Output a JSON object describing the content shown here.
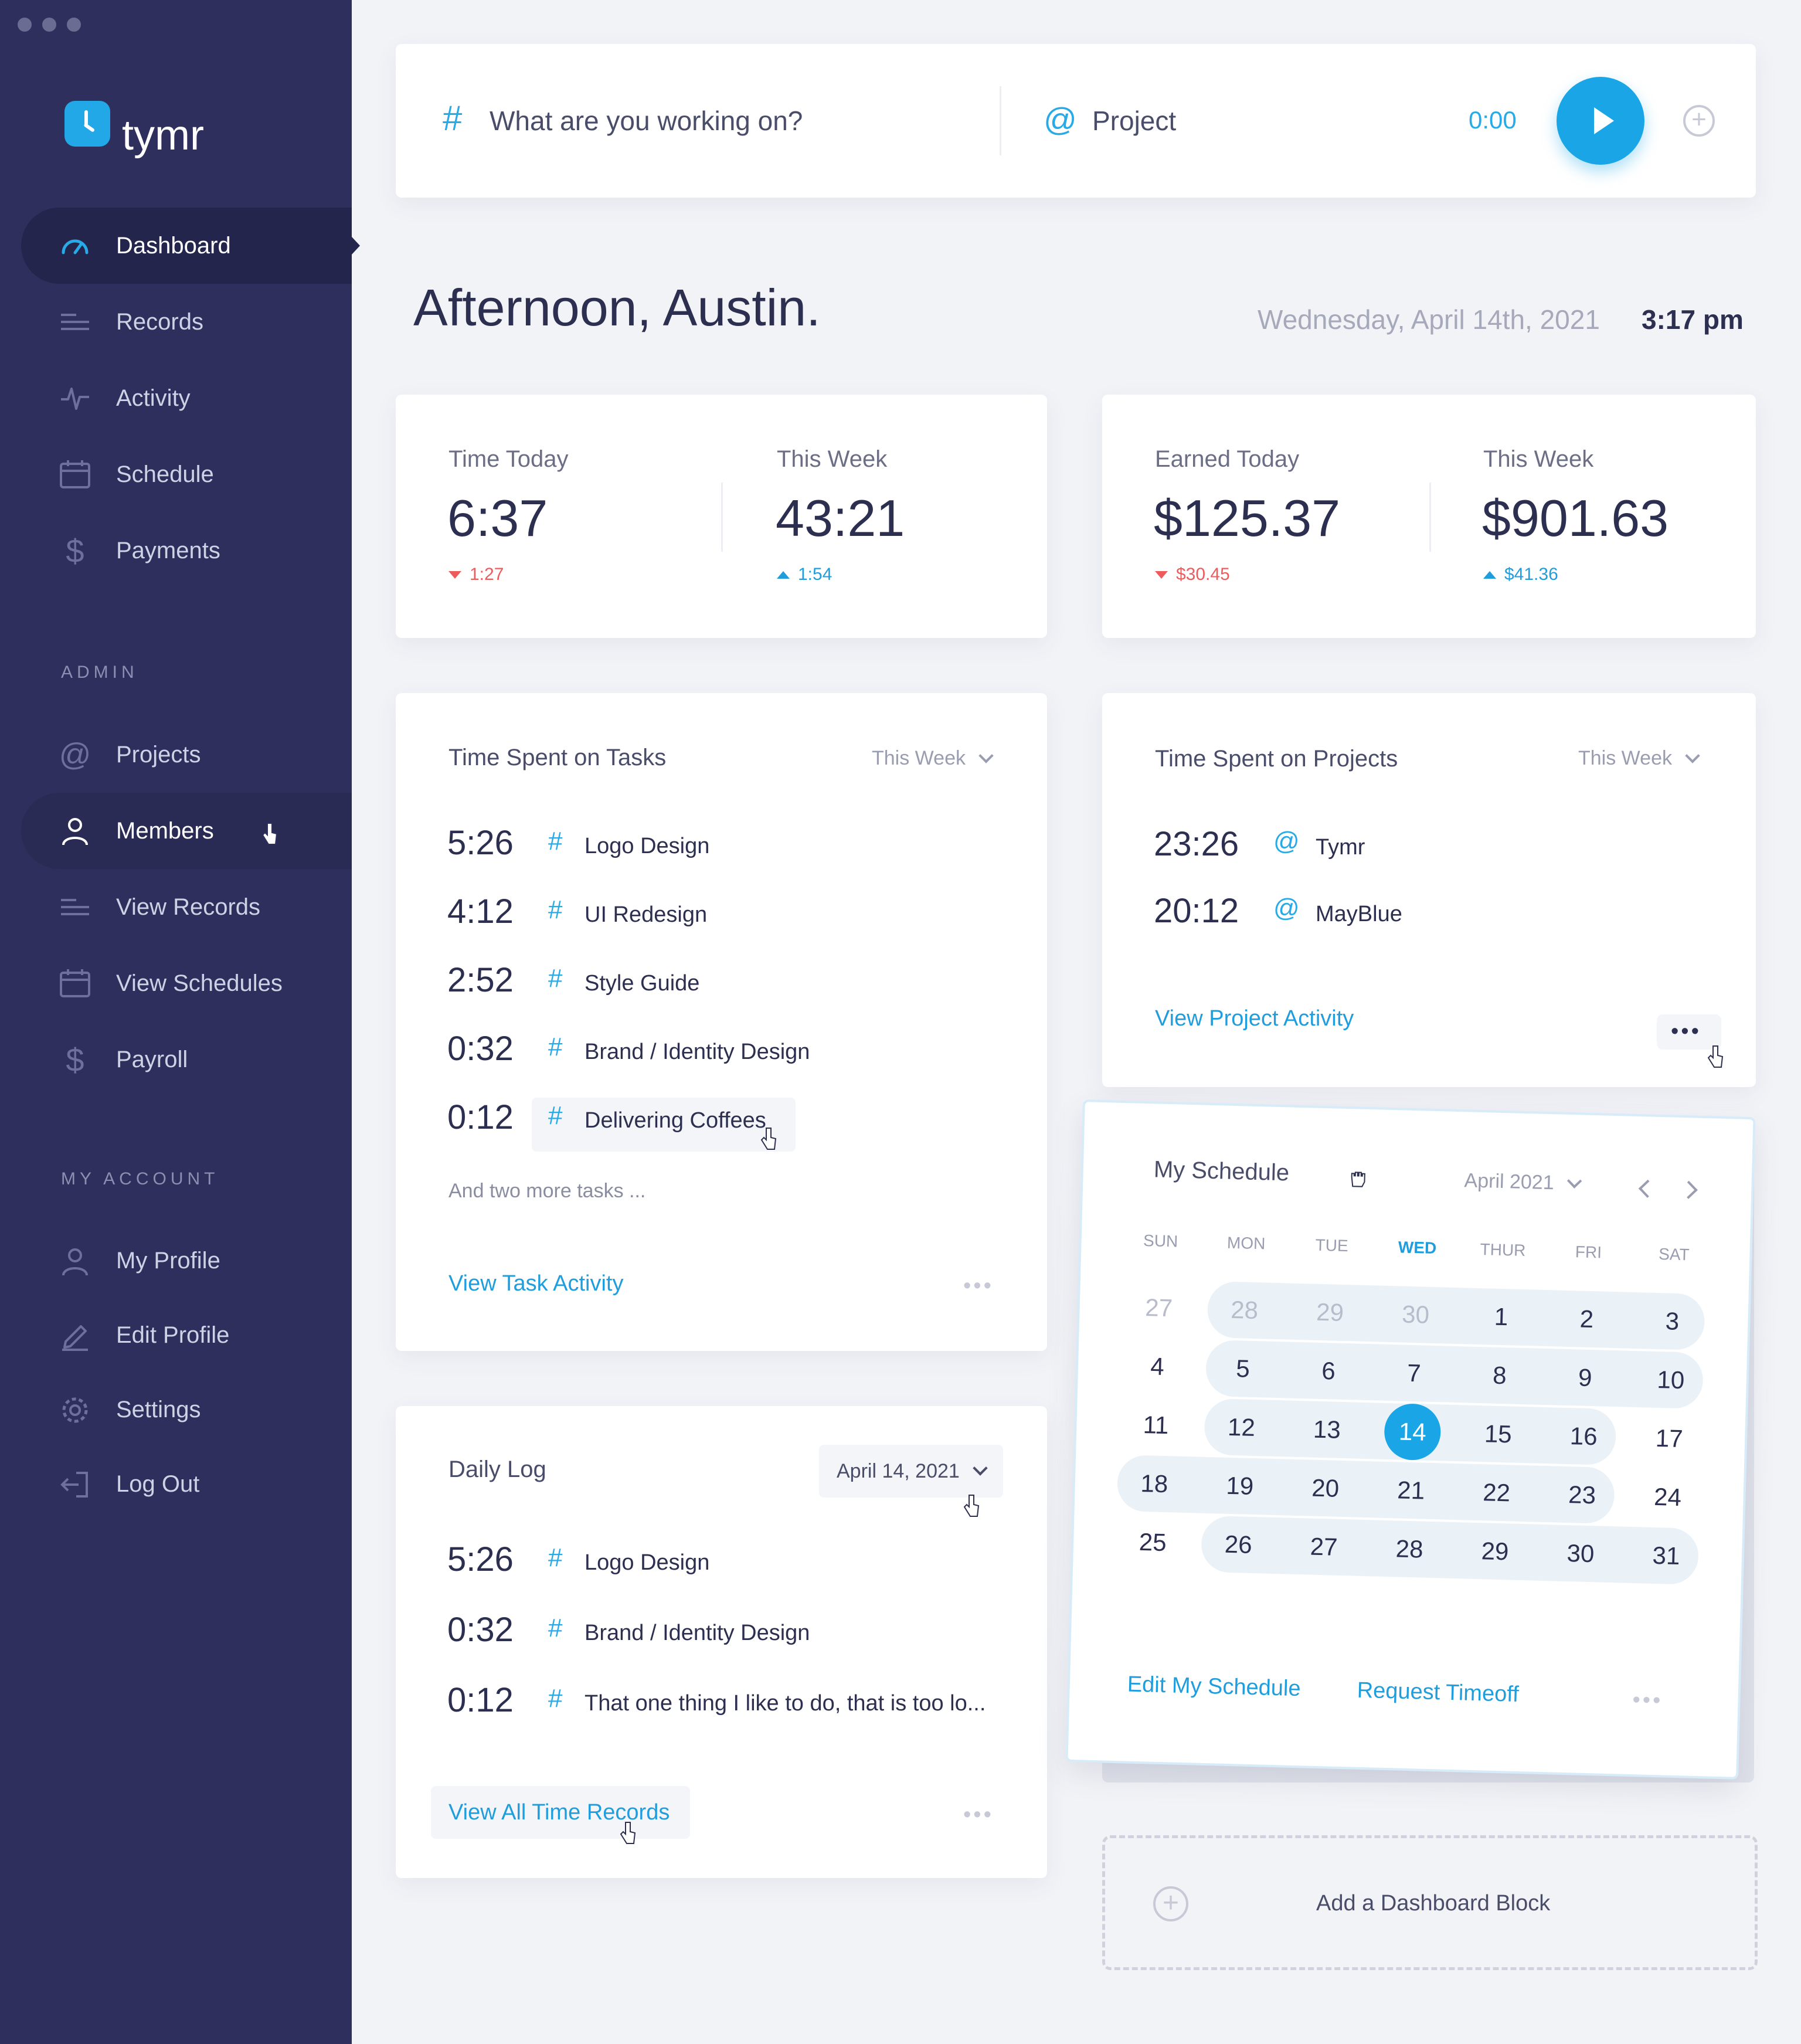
{
  "app": {
    "name": "tymr"
  },
  "sidebar": {
    "main_items": [
      {
        "label": "Dashboard",
        "icon": "gauge-icon"
      },
      {
        "label": "Records",
        "icon": "list-icon"
      },
      {
        "label": "Activity",
        "icon": "pulse-icon"
      },
      {
        "label": "Schedule",
        "icon": "calendar-icon"
      },
      {
        "label": "Payments",
        "icon": "dollar-icon"
      }
    ],
    "admin_label": "ADMIN",
    "admin_items": [
      {
        "label": "Projects",
        "icon": "at-icon"
      },
      {
        "label": "Members",
        "icon": "user-icon"
      },
      {
        "label": "View Records",
        "icon": "list-icon"
      },
      {
        "label": "View Schedules",
        "icon": "calendar-icon"
      },
      {
        "label": "Payroll",
        "icon": "dollar-icon"
      }
    ],
    "account_label": "MY ACCOUNT",
    "account_items": [
      {
        "label": "My Profile",
        "icon": "user-icon"
      },
      {
        "label": "Edit Profile",
        "icon": "pencil-icon"
      },
      {
        "label": "Settings",
        "icon": "gear-icon"
      },
      {
        "label": "Log Out",
        "icon": "logout-icon"
      }
    ]
  },
  "timer": {
    "task_placeholder": "What are you working on?",
    "project_placeholder": "Project",
    "elapsed": "0:00"
  },
  "header": {
    "greeting": "Afternoon, Austin.",
    "date": "Wednesday, April 14th, 2021",
    "time": "3:17 pm"
  },
  "time_stats": {
    "today_label": "Time Today",
    "today_value": "6:37",
    "today_delta": "1:27",
    "week_label": "This Week",
    "week_value": "43:21",
    "week_delta": "1:54"
  },
  "earn_stats": {
    "today_label": "Earned Today",
    "today_value": "$125.37",
    "today_delta": "$30.45",
    "week_label": "This Week",
    "week_value": "$901.63",
    "week_delta": "$41.36"
  },
  "tasks": {
    "title": "Time Spent on Tasks",
    "filter": "This Week",
    "rows": [
      {
        "time": "5:26",
        "label": "Logo Design"
      },
      {
        "time": "4:12",
        "label": "UI Redesign"
      },
      {
        "time": "2:52",
        "label": "Style Guide"
      },
      {
        "time": "0:32",
        "label": "Brand / Identity Design"
      },
      {
        "time": "0:12",
        "label": "Delivering Coffees"
      }
    ],
    "more": "And two more tasks ...",
    "link": "View Task Activity"
  },
  "projects": {
    "title": "Time Spent on Projects",
    "filter": "This Week",
    "rows": [
      {
        "time": "23:26",
        "label": "Tymr"
      },
      {
        "time": "20:12",
        "label": "MayBlue"
      }
    ],
    "link": "View Project Activity"
  },
  "daily_log": {
    "title": "Daily Log",
    "date": "April 14, 2021",
    "rows": [
      {
        "time": "5:26",
        "label": "Logo Design"
      },
      {
        "time": "0:32",
        "label": "Brand / Identity Design"
      },
      {
        "time": "0:12",
        "label": "That one thing I like to do, that is too lo..."
      }
    ],
    "link": "View All Time Records"
  },
  "schedule": {
    "title": "My Schedule",
    "month": "April 2021",
    "days_of_week": [
      "SUN",
      "MON",
      "TUE",
      "WED",
      "THUR",
      "FRI",
      "SAT"
    ],
    "weeks": [
      [
        "27",
        "28",
        "29",
        "30",
        "1",
        "2",
        "3"
      ],
      [
        "4",
        "5",
        "6",
        "7",
        "8",
        "9",
        "10"
      ],
      [
        "11",
        "12",
        "13",
        "14",
        "15",
        "16",
        "17"
      ],
      [
        "18",
        "19",
        "20",
        "21",
        "22",
        "23",
        "24"
      ],
      [
        "25",
        "26",
        "27",
        "28",
        "29",
        "30",
        "31"
      ]
    ],
    "today": "14",
    "edit_link": "Edit My Schedule",
    "timeoff_link": "Request Timeoff"
  },
  "add_block": {
    "label": "Add a Dashboard Block"
  },
  "colors": {
    "sidebar": "#2e2f5d",
    "accent": "#1aa6e6",
    "negative": "#ec5c5c"
  }
}
